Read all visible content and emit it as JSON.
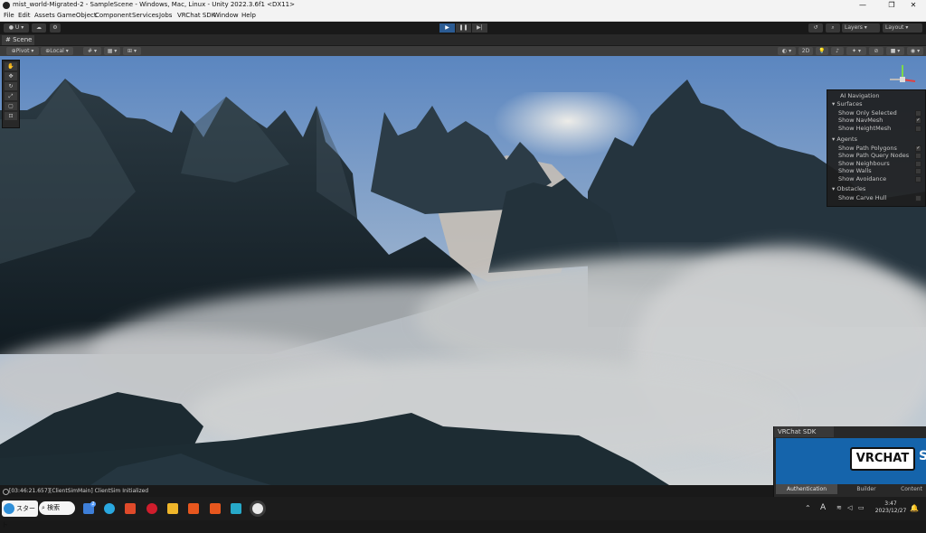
{
  "window": {
    "title": "mist_world-Migrated-2 - SampleScene - Windows, Mac, Linux - Unity 2022.3.6f1 <DX11>",
    "minimize": "—",
    "maximize": "❐",
    "close": "✕"
  },
  "menu": [
    "File",
    "Edit",
    "Assets",
    "GameObject",
    "Component",
    "Services",
    "Jobs",
    "VRChat SDK",
    "Window",
    "Help"
  ],
  "toolbar": {
    "account": "U",
    "layers": "Layers",
    "layout": "Layout"
  },
  "scene_tab": "Scene",
  "scene_toolbar": {
    "pivot": "Pivot",
    "local": "Local",
    "mode_2d": "2D"
  },
  "ai_navigation": {
    "title": "AI Navigation",
    "surfaces": {
      "header": "Surfaces",
      "items": [
        {
          "label": "Show Only Selected",
          "checked": false
        },
        {
          "label": "Show NavMesh",
          "checked": true
        },
        {
          "label": "Show HeightMesh",
          "checked": false
        }
      ]
    },
    "agents": {
      "header": "Agents",
      "items": [
        {
          "label": "Show Path Polygons",
          "checked": true
        },
        {
          "label": "Show Path Query Nodes",
          "checked": false
        },
        {
          "label": "Show Neighbours",
          "checked": false
        },
        {
          "label": "Show Walls",
          "checked": false
        },
        {
          "label": "Show Avoidance",
          "checked": false
        }
      ]
    },
    "obstacles": {
      "header": "Obstacles",
      "items": [
        {
          "label": "Show Carve Hull",
          "checked": false
        }
      ]
    }
  },
  "status": "[03:46:21.657][ClientSimMain] ClientSim Initialized",
  "vrchat_sdk": {
    "tab": "VRChat SDK",
    "logo": "VRCHAT",
    "logo_suffix": "S",
    "tabs": [
      "Authentication",
      "Builder",
      "Content"
    ]
  },
  "taskbar": {
    "start": "スタート",
    "search": "検索",
    "clock_time": "3:47",
    "clock_date": "2023/12/27",
    "ime": "A",
    "badge": "2"
  }
}
